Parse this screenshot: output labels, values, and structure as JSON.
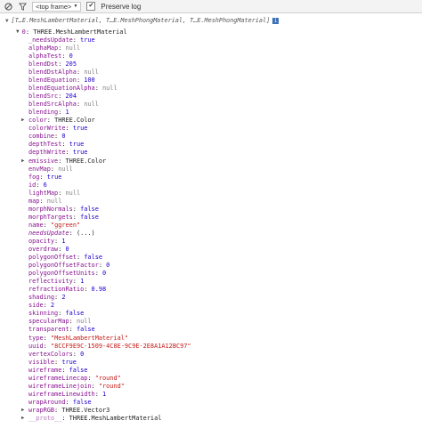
{
  "toolbar": {
    "frame_label": "<top frame>",
    "preserve_log_label": "Preserve log",
    "preserve_log_checked": true
  },
  "log": {
    "summary": "[T…E.MeshLambertMaterial, T…E.MeshPhongMaterial, T…E.MeshPhongMaterial]",
    "object_header_index": "0",
    "object_header_type": "THREE.MeshLambertMaterial",
    "properties": [
      {
        "key": "_needsUpdate",
        "value": "true",
        "type": "bool"
      },
      {
        "key": "alphaMap",
        "value": "null",
        "type": "null"
      },
      {
        "key": "alphaTest",
        "value": "0",
        "type": "num"
      },
      {
        "key": "blendDst",
        "value": "205",
        "type": "num"
      },
      {
        "key": "blendDstAlpha",
        "value": "null",
        "type": "null"
      },
      {
        "key": "blendEquation",
        "value": "100",
        "type": "num"
      },
      {
        "key": "blendEquationAlpha",
        "value": "null",
        "type": "null"
      },
      {
        "key": "blendSrc",
        "value": "204",
        "type": "num"
      },
      {
        "key": "blendSrcAlpha",
        "value": "null",
        "type": "null"
      },
      {
        "key": "blending",
        "value": "1",
        "type": "num"
      },
      {
        "key": "color",
        "value": "THREE.Color",
        "type": "obj",
        "expandable": true
      },
      {
        "key": "colorWrite",
        "value": "true",
        "type": "bool"
      },
      {
        "key": "combine",
        "value": "0",
        "type": "num"
      },
      {
        "key": "depthTest",
        "value": "true",
        "type": "bool"
      },
      {
        "key": "depthWrite",
        "value": "true",
        "type": "bool"
      },
      {
        "key": "emissive",
        "value": "THREE.Color",
        "type": "obj",
        "expandable": true
      },
      {
        "key": "envMap",
        "value": "null",
        "type": "null"
      },
      {
        "key": "fog",
        "value": "true",
        "type": "bool"
      },
      {
        "key": "id",
        "value": "6",
        "type": "num"
      },
      {
        "key": "lightMap",
        "value": "null",
        "type": "null"
      },
      {
        "key": "map",
        "value": "null",
        "type": "null"
      },
      {
        "key": "morphNormals",
        "value": "false",
        "type": "bool"
      },
      {
        "key": "morphTargets",
        "value": "false",
        "type": "bool"
      },
      {
        "key": "name",
        "value": "\"ggreen\"",
        "type": "str"
      },
      {
        "key": "needsUpdate",
        "value": "(...)",
        "type": "obj",
        "italic": true
      },
      {
        "key": "opacity",
        "value": "1",
        "type": "num"
      },
      {
        "key": "overdraw",
        "value": "0",
        "type": "num"
      },
      {
        "key": "polygonOffset",
        "value": "false",
        "type": "bool"
      },
      {
        "key": "polygonOffsetFactor",
        "value": "0",
        "type": "num"
      },
      {
        "key": "polygonOffsetUnits",
        "value": "0",
        "type": "num"
      },
      {
        "key": "reflectivity",
        "value": "1",
        "type": "num"
      },
      {
        "key": "refractionRatio",
        "value": "0.98",
        "type": "num"
      },
      {
        "key": "shading",
        "value": "2",
        "type": "num"
      },
      {
        "key": "side",
        "value": "2",
        "type": "num"
      },
      {
        "key": "skinning",
        "value": "false",
        "type": "bool"
      },
      {
        "key": "specularMap",
        "value": "null",
        "type": "null"
      },
      {
        "key": "transparent",
        "value": "false",
        "type": "bool"
      },
      {
        "key": "type",
        "value": "\"MeshLambertMaterial\"",
        "type": "str"
      },
      {
        "key": "uuid",
        "value": "\"8CCF9E9C-1509-4C8E-9C9E-2E8A1A12BC97\"",
        "type": "str"
      },
      {
        "key": "vertexColors",
        "value": "0",
        "type": "num"
      },
      {
        "key": "visible",
        "value": "true",
        "type": "bool"
      },
      {
        "key": "wireframe",
        "value": "false",
        "type": "bool"
      },
      {
        "key": "wireframeLinecap",
        "value": "\"round\"",
        "type": "str"
      },
      {
        "key": "wireframeLinejoin",
        "value": "\"round\"",
        "type": "str"
      },
      {
        "key": "wireframeLinewidth",
        "value": "1",
        "type": "num"
      },
      {
        "key": "wrapAround",
        "value": "false",
        "type": "bool"
      },
      {
        "key": "wrapRGB",
        "value": "THREE.Vector3",
        "type": "obj",
        "expandable": true
      },
      {
        "key": "__proto__",
        "value": "THREE.MeshLambertMaterial",
        "type": "obj",
        "expandable": true,
        "dim": true
      }
    ]
  }
}
